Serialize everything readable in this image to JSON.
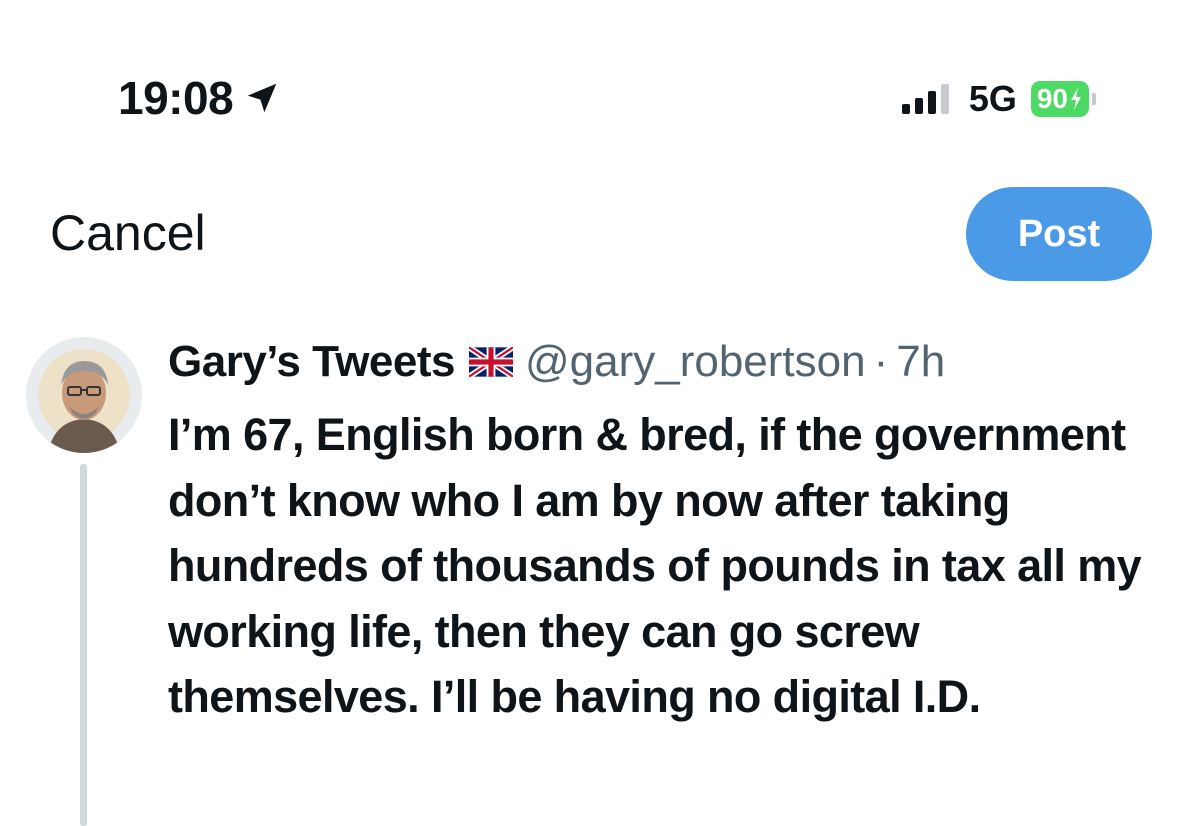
{
  "status_bar": {
    "time": "19:08",
    "network": "5G",
    "battery": "90",
    "icons": [
      "location-arrow-icon",
      "signal-bars-icon",
      "battery-charging-icon"
    ]
  },
  "header": {
    "cancel_label": "Cancel",
    "post_label": "Post",
    "post_color": "#4a9ae8"
  },
  "tweet": {
    "display_name": "Gary’s Tweets",
    "flag_icon": "uk-flag-icon",
    "handle": "@gary_robertson",
    "separator": "·",
    "time_ago": "7h",
    "text": "I’m 67, English born & bred, if the government don’t know who I am by now after taking hundreds of thousands of pounds in tax all my working life, then they can go screw themselves. I’ll be having no digital I.D."
  },
  "colors": {
    "text_primary": "#0f1419",
    "text_secondary": "#536471",
    "battery_green": "#4cd964",
    "thread_line": "#cfd9de"
  }
}
